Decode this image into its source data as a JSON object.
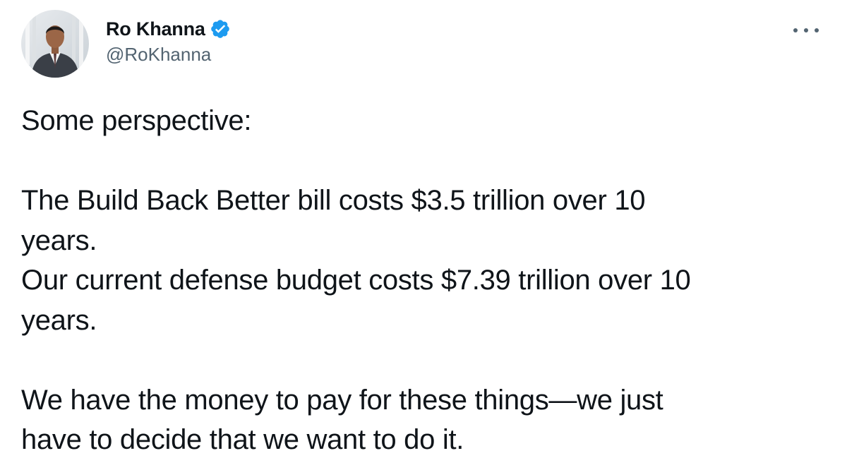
{
  "author": {
    "display_name": "Ro Khanna",
    "handle": "@RoKhanna",
    "verified": true,
    "avatar_icon": "profile-photo",
    "verified_color": "#1d9bf0"
  },
  "menu": {
    "icon": "more-horizontal-icon"
  },
  "tweet": {
    "lines": [
      "Some perspective:",
      "",
      "The Build Back Better bill costs $3.5 trillion over 10",
      "years.",
      "Our current defense budget costs $7.39 trillion over 10",
      "years.",
      "",
      "We have the money to pay for these things—we just",
      "have to decide that we want to do it."
    ]
  }
}
